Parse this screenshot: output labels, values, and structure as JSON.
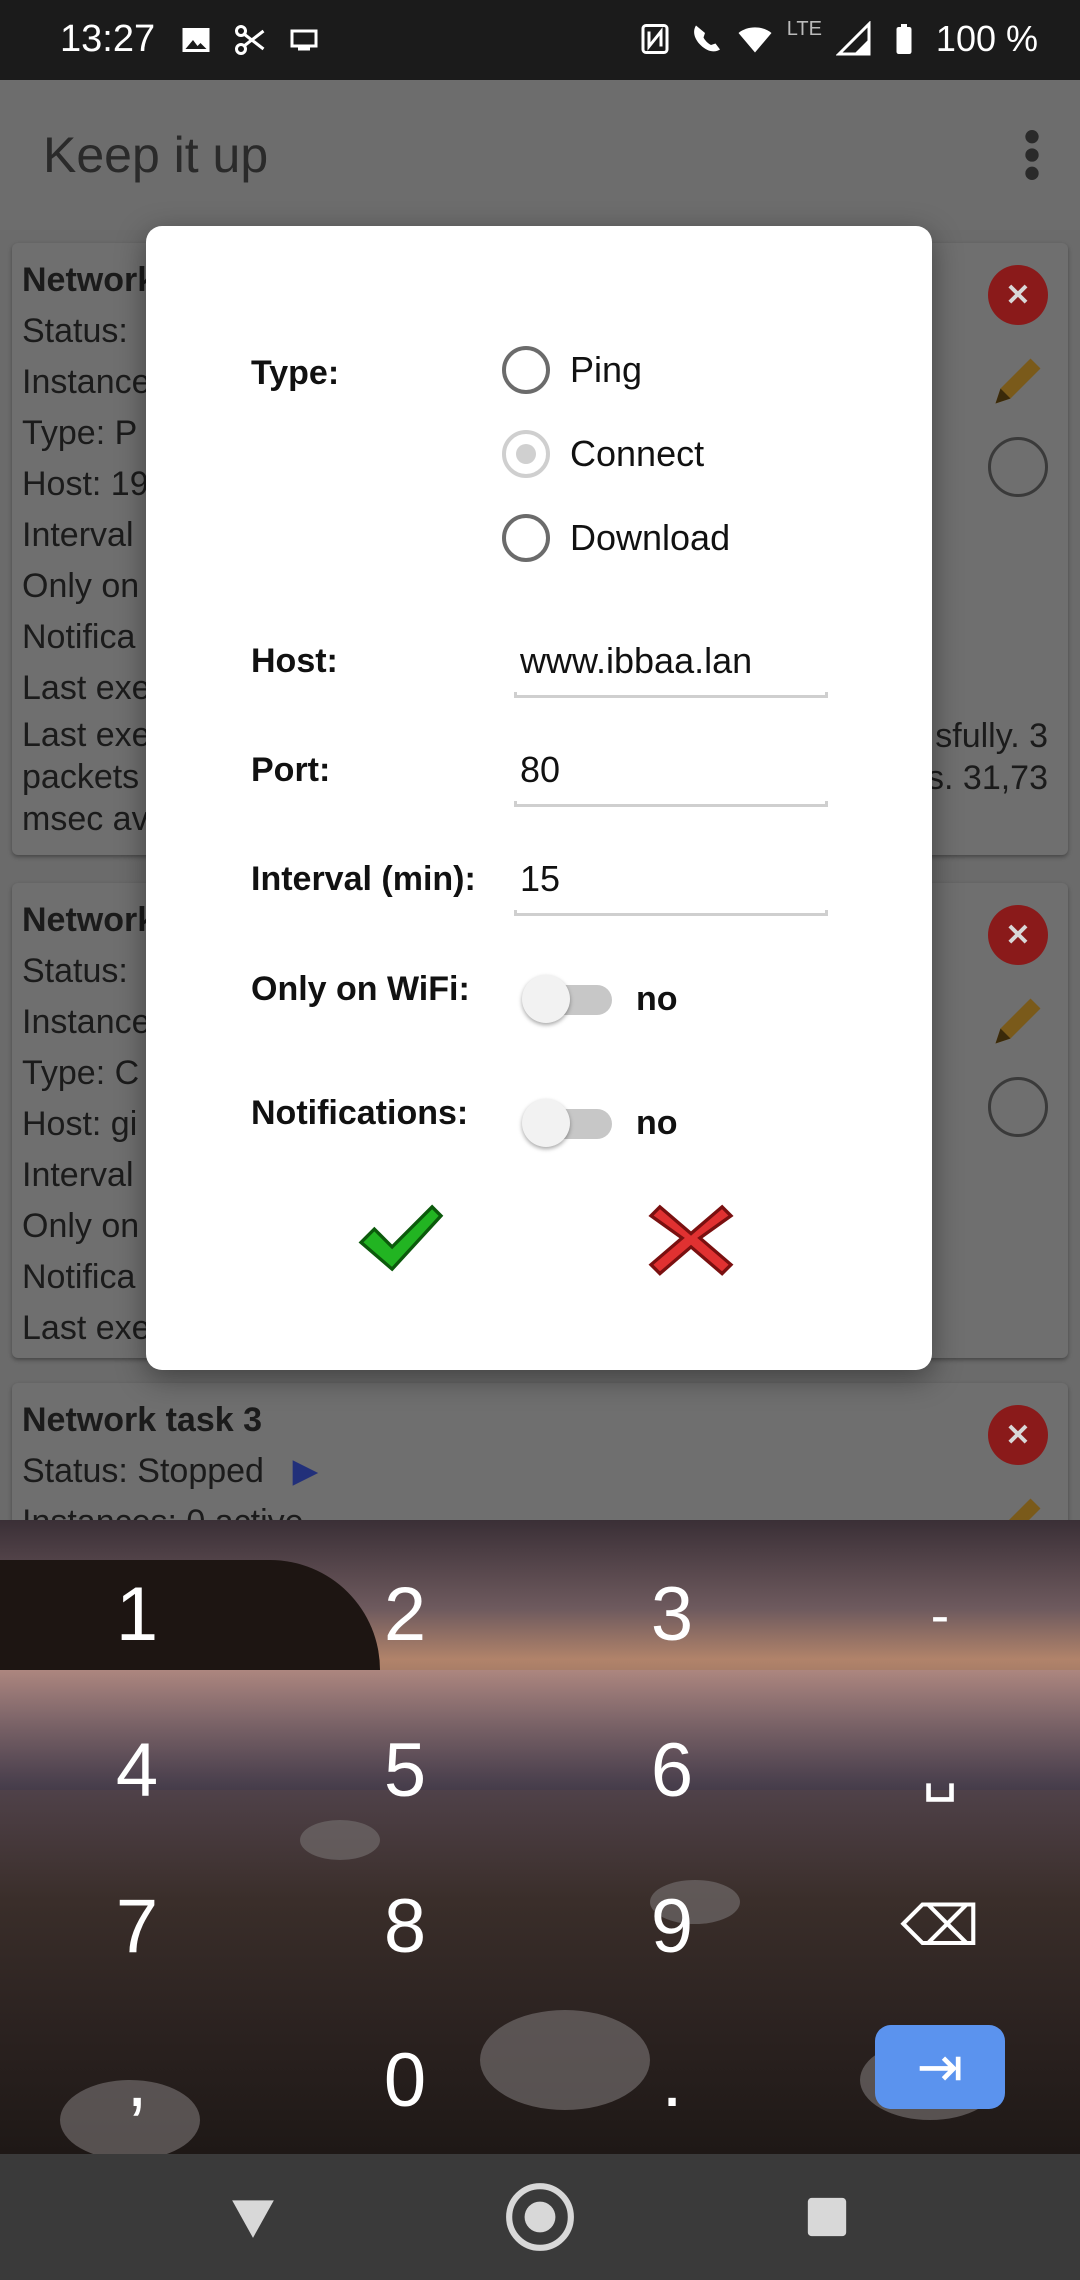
{
  "status_bar": {
    "time": "13:27",
    "battery": "100 %",
    "network": "LTE",
    "left_icons": [
      "image-icon",
      "scissors-icon",
      "screen-icon"
    ],
    "right_icons": [
      "nfc-icon",
      "wifi-call-icon",
      "wifi-icon",
      "signal-icon",
      "battery-icon"
    ]
  },
  "app_bar": {
    "title": "Keep it up",
    "menu_icon": "more-vert-icon"
  },
  "background_cards": [
    {
      "lines": [
        "Network",
        "Status:",
        "Instance",
        "Type: P",
        "Host: 19",
        "Interval",
        "Only on",
        "Notifica",
        "Last exe",
        "Last exe",
        "packets",
        "msec av"
      ],
      "right_fragments": [
        "sfully. 3",
        "s. 31,73"
      ]
    },
    {
      "lines": [
        "Network",
        "Status:",
        "Instance",
        "Type: C",
        "Host: gi",
        "Interval",
        "Only on",
        "Notifica",
        "Last exe"
      ]
    },
    {
      "lines": [
        "Network task 3",
        "Status: Stopped",
        "Instances: 0 active"
      ]
    }
  ],
  "dialog": {
    "type_label": "Type:",
    "type_options": [
      {
        "label": "Ping",
        "checked": false
      },
      {
        "label": "Connect",
        "checked": true
      },
      {
        "label": "Download",
        "checked": false
      }
    ],
    "host_label": "Host:",
    "host_value": "www.ibbaa.lan",
    "port_label": "Port:",
    "port_value": "80",
    "interval_label": "Interval (min):",
    "interval_value": "15",
    "wifi_label": "Only on WiFi:",
    "wifi_value": "no",
    "notifications_label": "Notifications:",
    "notifications_value": "no",
    "ok_icon": "checkmark-icon",
    "cancel_icon": "cross-icon",
    "ok_color": "#22b422",
    "cancel_color": "#e03131"
  },
  "keyboard": {
    "row1": [
      "1",
      "2",
      "3",
      "-"
    ],
    "row2": [
      "4",
      "5",
      "6",
      "␣"
    ],
    "row3": [
      "7",
      "8",
      "9",
      "⌫"
    ],
    "row4": [
      ",",
      "0",
      ".",
      "⇥"
    ],
    "enter_color": "#5b93ee"
  },
  "nav_bar": {
    "back": "back-icon",
    "home": "home-icon",
    "recents": "recents-icon"
  }
}
